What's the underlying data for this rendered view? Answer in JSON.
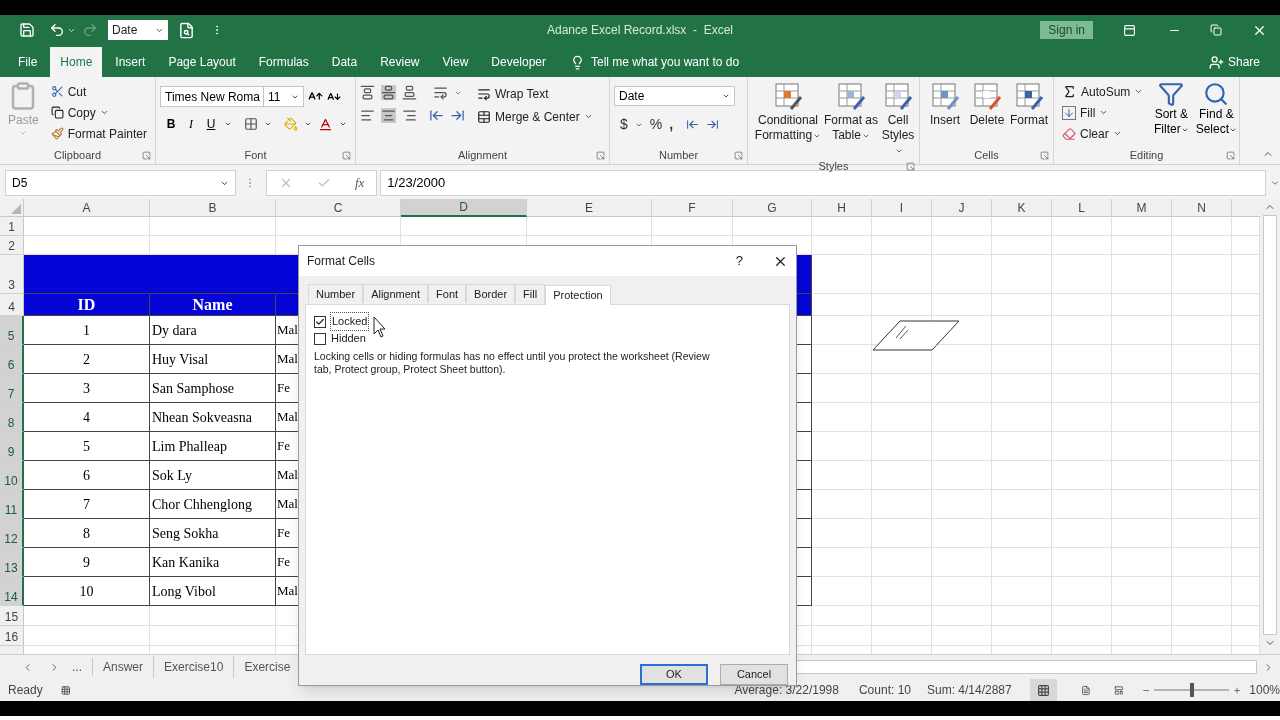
{
  "quick_access": {
    "style_box": "Date"
  },
  "window": {
    "title": "Adance Excel Record.xlsx  -  Excel",
    "sign_in": "Sign in"
  },
  "menu_tabs": [
    {
      "label": "File",
      "selected": false
    },
    {
      "label": "Home",
      "selected": true
    },
    {
      "label": "Insert",
      "selected": false
    },
    {
      "label": "Page Layout",
      "selected": false
    },
    {
      "label": "Formulas",
      "selected": false
    },
    {
      "label": "Data",
      "selected": false
    },
    {
      "label": "Review",
      "selected": false
    },
    {
      "label": "View",
      "selected": false
    },
    {
      "label": "Developer",
      "selected": false
    }
  ],
  "tell_me": "Tell me what you want to do",
  "share": "Share",
  "ribbon": {
    "clipboard": {
      "paste": "Paste",
      "cut": "Cut",
      "copy": "Copy",
      "format_painter": "Format Painter",
      "label": "Clipboard"
    },
    "font": {
      "font_name": "Times New Roma",
      "font_size": "11",
      "bold": "B",
      "italic": "I",
      "underline": "U",
      "label": "Font"
    },
    "alignment": {
      "wrap_text": "Wrap Text",
      "merge_center": "Merge & Center",
      "label": "Alignment"
    },
    "number": {
      "format": "Date",
      "currency": "$",
      "percent": "%",
      "comma": ",",
      "label": "Number"
    },
    "styles": {
      "conditional_formatting": "Conditional Formatting",
      "format_as_table": "Format as Table",
      "cell_styles": "Cell Styles",
      "label": "Styles"
    },
    "cells": {
      "insert": "Insert",
      "delete": "Delete",
      "format": "Format",
      "label": "Cells"
    },
    "editing": {
      "autosum": "AutoSum",
      "fill": "Fill",
      "clear": "Clear",
      "sort_filter": "Sort & Filter",
      "find_select": "Find & Select",
      "label": "Editing"
    }
  },
  "formula_bar": {
    "name_box": "D5",
    "function_label": "fx",
    "value": "1/23/2000"
  },
  "sheet": {
    "columns": [
      {
        "label": "A",
        "selected": false
      },
      {
        "label": "B",
        "selected": false
      },
      {
        "label": "C",
        "selected": false
      },
      {
        "label": "D",
        "selected": true
      },
      {
        "label": "E",
        "selected": false
      },
      {
        "label": "F",
        "selected": false
      },
      {
        "label": "G",
        "selected": false
      },
      {
        "label": "H",
        "selected": false
      },
      {
        "label": "I",
        "selected": false
      },
      {
        "label": "J",
        "selected": false
      },
      {
        "label": "K",
        "selected": false
      },
      {
        "label": "L",
        "selected": false
      },
      {
        "label": "M",
        "selected": false
      },
      {
        "label": "N",
        "selected": false
      }
    ],
    "rows": [
      {
        "label": "1",
        "selected": false,
        "kind": "blank"
      },
      {
        "label": "2",
        "selected": false,
        "kind": "blank"
      },
      {
        "label": "3",
        "selected": false,
        "kind": "banner"
      },
      {
        "label": "4",
        "selected": false,
        "kind": "header",
        "cells": [
          "ID",
          "Name"
        ]
      },
      {
        "label": "5",
        "selected": true,
        "kind": "record",
        "cells": [
          "1",
          "Dy dara",
          "Mal"
        ]
      },
      {
        "label": "6",
        "selected": true,
        "kind": "record",
        "cells": [
          "2",
          "Huy Visal",
          "Mal"
        ]
      },
      {
        "label": "7",
        "selected": true,
        "kind": "record",
        "cells": [
          "3",
          "San Samphose",
          "Fe"
        ]
      },
      {
        "label": "8",
        "selected": true,
        "kind": "record",
        "cells": [
          "4",
          "Nhean Sokveasna",
          "Mal"
        ]
      },
      {
        "label": "9",
        "selected": true,
        "kind": "record",
        "cells": [
          "5",
          "Lim Phalleap",
          "Fe"
        ]
      },
      {
        "label": "10",
        "selected": true,
        "kind": "record",
        "cells": [
          "6",
          "Sok Ly",
          "Mal"
        ]
      },
      {
        "label": "11",
        "selected": true,
        "kind": "record",
        "cells": [
          "7",
          "Chor Chhenglong",
          "Mal"
        ]
      },
      {
        "label": "12",
        "selected": true,
        "kind": "record",
        "cells": [
          "8",
          "Seng Sokha",
          "Fe"
        ]
      },
      {
        "label": "13",
        "selected": true,
        "kind": "record",
        "cells": [
          "9",
          "Kan Kanika",
          "Fe"
        ]
      },
      {
        "label": "14",
        "selected": true,
        "kind": "record",
        "cells": [
          "10",
          "Long Vibol",
          "Mal"
        ]
      },
      {
        "label": "15",
        "selected": false,
        "kind": "blank"
      },
      {
        "label": "16",
        "selected": false,
        "kind": "blank"
      }
    ]
  },
  "sheet_tabs": {
    "more": "...",
    "tabs": [
      {
        "label": "Answer",
        "selected": false
      },
      {
        "label": "Exercise10",
        "selected": false
      },
      {
        "label": "Exercise",
        "selected": false
      }
    ]
  },
  "dialog": {
    "title": "Format Cells",
    "help": "?",
    "tabs": [
      {
        "label": "Number",
        "selected": false
      },
      {
        "label": "Alignment",
        "selected": false
      },
      {
        "label": "Font",
        "selected": false
      },
      {
        "label": "Border",
        "selected": false
      },
      {
        "label": "Fill",
        "selected": false
      },
      {
        "label": "Protection",
        "selected": true
      }
    ],
    "options": [
      {
        "label": "Locked",
        "checked": true
      },
      {
        "label": "Hidden",
        "checked": false
      }
    ],
    "note": "Locking cells or hiding formulas has no effect until you protect the worksheet (Review tab, Protect group, Protect Sheet button).",
    "buttons": [
      {
        "label": "OK",
        "kind": "default"
      },
      {
        "label": "Cancel",
        "kind": "normal"
      }
    ]
  },
  "status_bar": {
    "mode": "Ready",
    "average": "Average: 3/22/1998",
    "count": "Count: 10",
    "sum": "Sum: 4/14/2887",
    "zoom": {
      "level": 0.5,
      "reading": "100%"
    }
  }
}
